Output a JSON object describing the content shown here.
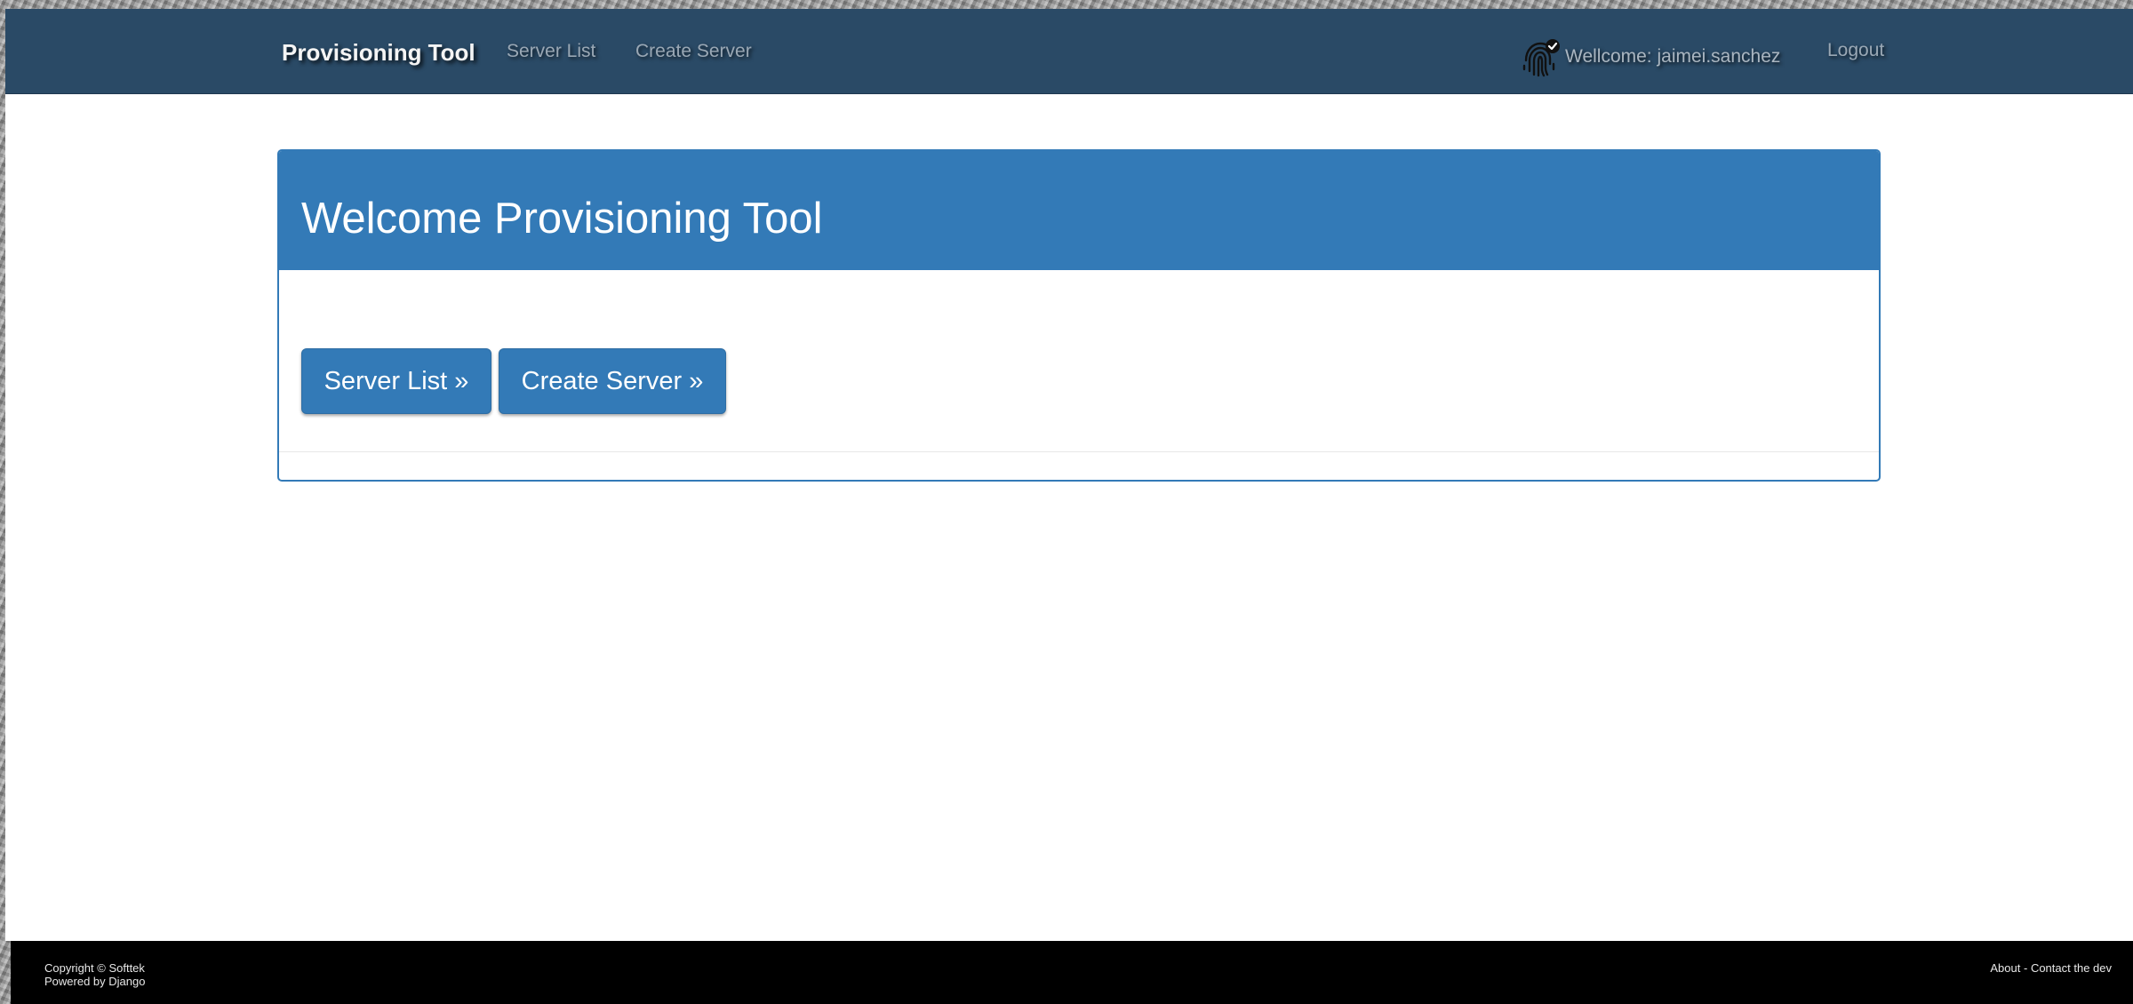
{
  "navbar": {
    "brand": "Provisioning Tool",
    "links": {
      "server_list": "Server List",
      "create_server": "Create Server"
    },
    "user_icon": "fingerprint-check-icon",
    "welcome_text": "Wellcome: jaimei.sanchez",
    "logout": "Logout",
    "background_color": "#2a4a66"
  },
  "panel": {
    "title": "Welcome Provisioning Tool",
    "buttons": {
      "server_list": "Server List »",
      "create_server": "Create Server »"
    },
    "accent_color": "#337ab7"
  },
  "footer": {
    "copyright": "Copyright © Softtek",
    "powered_by": "Powered by Django",
    "about": "About",
    "separator": " - ",
    "contact": "Contact the dev"
  }
}
